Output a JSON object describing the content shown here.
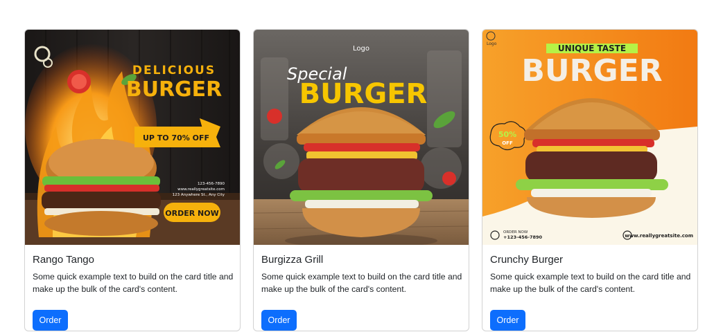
{
  "cards": [
    {
      "title": "Rango Tango",
      "text": "Some quick example text to build on the card title and make up the bulk of the card's content.",
      "button": "Order",
      "image": {
        "headline_top": "DELICIOUS",
        "headline_main": "BURGER",
        "promo": "UP TO 70% OFF",
        "phone": "123-456-7890",
        "site": "www.reallygreatsite.com",
        "address": "123 Anywhere St., Any City",
        "cta": "ORDER NOW",
        "colors": {
          "background": "#1f1c1a",
          "accent": "#f6b10c",
          "flame": "#f28a12"
        }
      }
    },
    {
      "title": "Burgizza Grill",
      "text": "Some quick example text to build on the card title and make up the bulk of the card's content.",
      "button": "Order",
      "image": {
        "logo": "Logo",
        "script": "Special",
        "headline_main": "BURGER",
        "colors": {
          "background": "#4a4642",
          "accent": "#f7c600",
          "table": "#b08a63"
        }
      }
    },
    {
      "title": "Crunchy Burger",
      "text": "Some quick example text to build on the card title and make up the bulk of the card's content.",
      "button": "Order",
      "image": {
        "logo": "Logo",
        "headline_top": "UNIQUE TASTE",
        "headline_main": "BURGER",
        "badge_value": "50%",
        "badge_label": "OFF",
        "order_label": "ORDER NOW",
        "phone": "+123-456-7890",
        "site": "www.reallygreatsite.com",
        "colors": {
          "background": "#f7891b",
          "accent": "#b6f246",
          "cream": "#fbf6e8"
        }
      }
    }
  ]
}
